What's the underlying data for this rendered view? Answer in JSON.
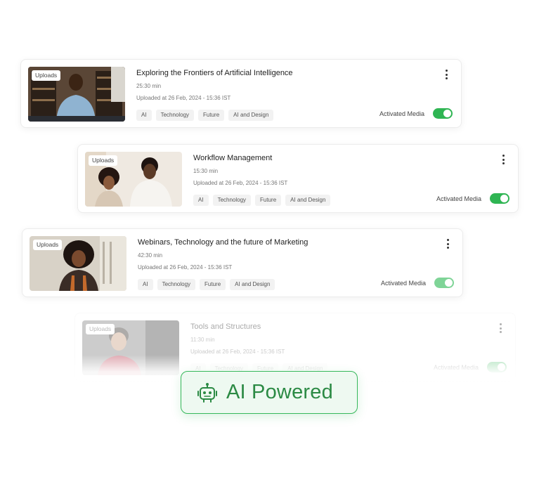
{
  "cards": [
    {
      "badge": "Uploads",
      "title": "Exploring the Frontiers of Artificial Intelligence",
      "duration": "25:30 min",
      "uploaded": "Uploaded at 26 Feb, 2024 - 15:36 IST",
      "tags": [
        "AI",
        "Technology",
        "Future",
        "AI and Design"
      ],
      "status": "Activated Media",
      "active": true
    },
    {
      "badge": "Uploads",
      "title": "Workflow Management",
      "duration": "15:30 min",
      "uploaded": "Uploaded at 26 Feb, 2024 - 15:36 IST",
      "tags": [
        "AI",
        "Technology",
        "Future",
        "AI and Design"
      ],
      "status": "Activated Media",
      "active": true
    },
    {
      "badge": "Uploads",
      "title": "Webinars, Technology and the future of Marketing",
      "duration": "42:30 min",
      "uploaded": "Uploaded at 26 Feb, 2024 - 15:36 IST",
      "tags": [
        "AI",
        "Technology",
        "Future",
        "AI and Design"
      ],
      "status": "Activated Media",
      "active": true
    },
    {
      "badge": "Uploads",
      "title": "Tools and Structures",
      "duration": "11:30 min",
      "uploaded": "Uploaded at 26 Feb, 2024 - 15:36 IST",
      "tags": [
        "AI",
        "Technology",
        "Future",
        "AI and Design"
      ],
      "status": "Activated Media",
      "active": true
    }
  ],
  "ai_badge": {
    "label": "AI Powered",
    "icon": "robot-icon"
  },
  "colors": {
    "accent": "#2fb553",
    "badge_text": "#2b8a44",
    "badge_bg": "#eef9f1"
  }
}
